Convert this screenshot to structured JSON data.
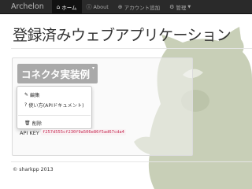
{
  "navbar": {
    "brand": "Archelon",
    "items": [
      {
        "icon": "home-icon",
        "glyph": "⌂",
        "label": "ホーム",
        "active": true
      },
      {
        "icon": "info-icon",
        "glyph": "ⓘ",
        "label": "About",
        "active": false
      },
      {
        "icon": "plus-circle-icon",
        "glyph": "⊕",
        "label": "アカウント追加",
        "active": false
      },
      {
        "icon": "gear-icon",
        "glyph": "⚙",
        "label": "管理",
        "active": false,
        "dropdown": true
      }
    ]
  },
  "page": {
    "title": "登録済みウェブアプリケーション"
  },
  "connector": {
    "label": "コネクタ実装例",
    "menu": {
      "edit": {
        "icon": "pencil-icon",
        "glyph": "✎",
        "label": "編集"
      },
      "usage": {
        "icon": "question-icon",
        "glyph": "?",
        "label": "使い方(APIドキュメント)"
      },
      "delete": {
        "icon": "trash-icon",
        "glyph": "🗑",
        "label": "削除"
      }
    },
    "api_key_label": "API KEY",
    "api_key": "f257d555cf230f9a506e86f5ad67cda4"
  },
  "footer": {
    "copyright": "© sharkpp 2013"
  },
  "colors": {
    "navbar_bg": "#2a2a2a",
    "connector_button_bg": "#a9a9a9",
    "api_key_text": "#c7254e",
    "creature": "#c4cbb3"
  }
}
